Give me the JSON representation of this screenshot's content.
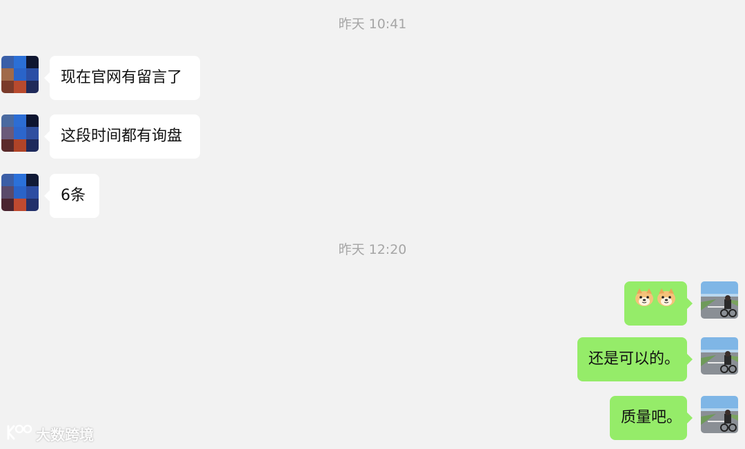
{
  "timestamps": [
    "昨天 10:41",
    "昨天 12:20"
  ],
  "messages_left": [
    {
      "text": "现在官网有留言了"
    },
    {
      "text": "这段时间都有询盘"
    },
    {
      "text": "6条"
    }
  ],
  "messages_right": [
    {
      "emoji": [
        "doge-emoji",
        "doge-emoji"
      ]
    },
    {
      "text": "还是可以的。"
    },
    {
      "text": "质量吧。"
    }
  ],
  "colors": {
    "background": "#f2f2f2",
    "bubble_left": "#ffffff",
    "bubble_right": "#95ec69",
    "timestamp": "#a6a6a6"
  },
  "watermark": {
    "text": "大数跨境"
  }
}
